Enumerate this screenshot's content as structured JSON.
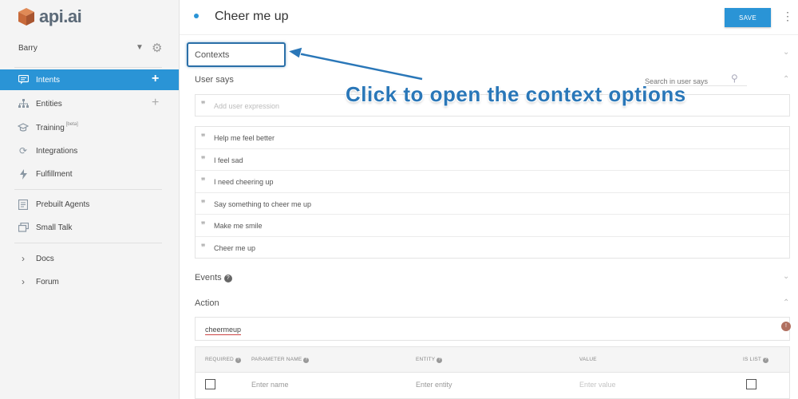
{
  "app": {
    "logo_text": "api.ai"
  },
  "sidebar": {
    "agent_name": "Barry",
    "items": [
      {
        "label": "Intents",
        "icon": "chat-bubble-icon",
        "has_add": true,
        "active": true
      },
      {
        "label": "Entities",
        "icon": "hierarchy-icon",
        "has_add": true,
        "active": false
      },
      {
        "label": "Training",
        "icon": "graduation-cap-icon",
        "badge": "[beta]",
        "active": false
      },
      {
        "label": "Integrations",
        "icon": "sync-icon",
        "active": false
      },
      {
        "label": "Fulfillment",
        "icon": "lightning-icon",
        "active": false
      },
      {
        "label": "Prebuilt Agents",
        "icon": "document-icon",
        "active": false
      },
      {
        "label": "Small Talk",
        "icon": "chat-stack-icon",
        "active": false
      },
      {
        "label": "Docs",
        "icon": "chevron-right-icon",
        "active": false
      },
      {
        "label": "Forum",
        "icon": "chevron-right-icon",
        "active": false
      }
    ],
    "colors": {
      "active_bg": "#2a94d6"
    }
  },
  "header": {
    "title": "Cheer me up",
    "save_label": "SAVE"
  },
  "contexts": {
    "label": "Contexts"
  },
  "user_says": {
    "title": "User says",
    "search_placeholder": "Search in user says",
    "add_placeholder": "Add user expression",
    "phrases": [
      "Help me feel better",
      "I feel sad",
      "I need cheering up",
      "Say something to cheer me up",
      "Make me smile",
      "Cheer me up"
    ]
  },
  "events": {
    "title": "Events"
  },
  "action": {
    "title": "Action",
    "value": "cheermeup",
    "badge": "!"
  },
  "parameters": {
    "headers": {
      "required": "REQUIRED",
      "name": "PARAMETER NAME",
      "entity": "ENTITY",
      "value": "VALUE",
      "is_list": "IS LIST"
    },
    "row": {
      "name_placeholder": "Enter name",
      "entity_placeholder": "Enter entity",
      "value_placeholder": "Enter value"
    }
  },
  "annotation": {
    "text": "Click to open the context options",
    "color": "#2a77b8"
  }
}
